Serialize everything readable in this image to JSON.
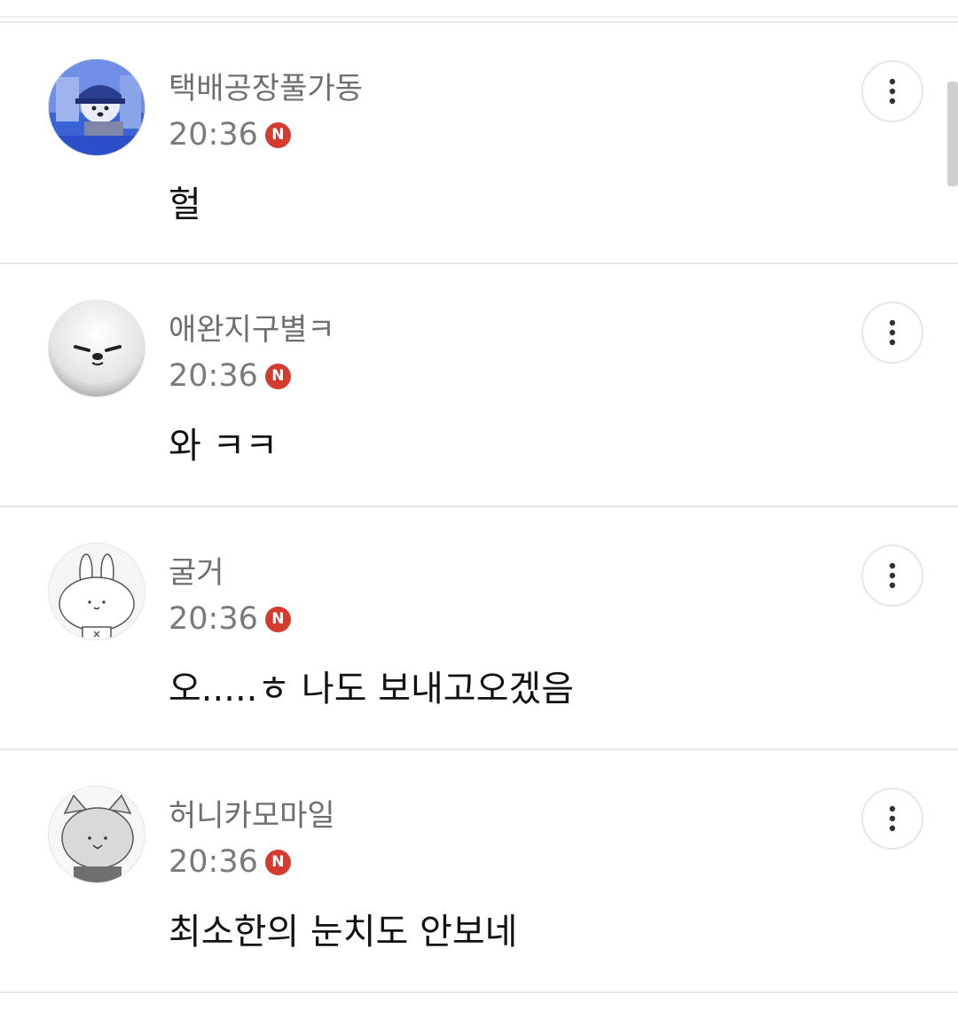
{
  "comments": [
    {
      "nickname": "택배공장풀가동",
      "time": "20:36",
      "badge": "N",
      "text": "헐",
      "avatar_icon": "dog-cap-photo-avatar",
      "more_icon": "more-vertical-icon"
    },
    {
      "nickname": "애완지구별ㅋ",
      "time": "20:36",
      "badge": "N",
      "text": "와 ㅋㅋ",
      "avatar_icon": "white-seal-avatar",
      "more_icon": "more-vertical-icon"
    },
    {
      "nickname": "굴거",
      "time": "20:36",
      "badge": "N",
      "text": "오.....ㅎ 나도 보내고오겠음",
      "avatar_icon": "bunny-avatar",
      "more_icon": "more-vertical-icon"
    },
    {
      "nickname": "허니카모마일",
      "time": "20:36",
      "badge": "N",
      "text": "최소한의 눈치도 안보네",
      "avatar_icon": "cat-avatar",
      "more_icon": "more-vertical-icon"
    }
  ],
  "colors": {
    "badge": "#d43a2d",
    "nickname": "#6e6e6e",
    "time": "#7a7a7a",
    "body_text": "#111111",
    "divider": "#e8e8e8"
  }
}
